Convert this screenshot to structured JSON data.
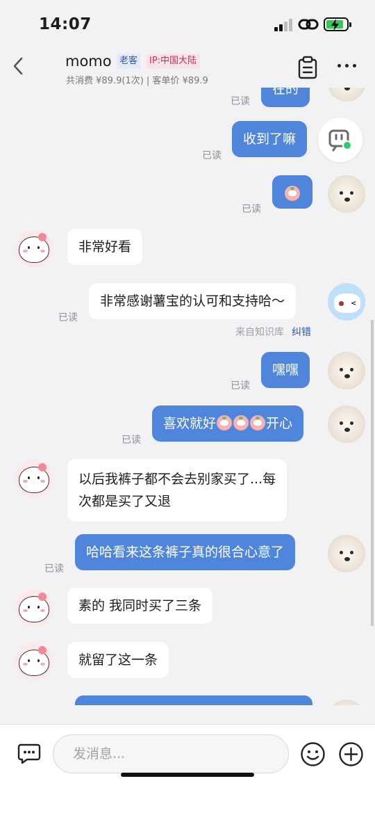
{
  "status_bar": {
    "time": "14:07"
  },
  "header": {
    "name": "momo",
    "tag_customer": "老客",
    "tag_ip": "IP:中国大陆",
    "summary": "共消费 ¥89.9(1次) | 客单价 ¥89.9"
  },
  "messages": [
    {
      "from": "agent",
      "text": "在的",
      "status": "已读"
    },
    {
      "from": "agent",
      "text": "收到了嘛",
      "status": "已读"
    },
    {
      "from": "agent",
      "text": "",
      "emoji": "peach-emoji",
      "status": "已读"
    },
    {
      "from": "customer",
      "text": "非常好看"
    },
    {
      "from": "bot",
      "text": "非常感谢薯宝的认可和支持哈～",
      "status": "已读",
      "source": "来自知识库",
      "correct": "纠错"
    },
    {
      "from": "agent",
      "text": "嘿嘿",
      "status": "已读"
    },
    {
      "from": "agent",
      "text_before": "喜欢就好",
      "text_after": "开心",
      "emoji": "peach-emoji",
      "status": "已读"
    },
    {
      "from": "customer",
      "line1": "以后我裤子都不会去别家买了...每",
      "line2": "次都是买了又退"
    },
    {
      "from": "agent",
      "text": "哈哈看来这条裤子真的很合心意了",
      "status": "已读"
    },
    {
      "from": "customer",
      "text": "素的 我同时买了三条"
    },
    {
      "from": "customer",
      "text": "就留了这一条"
    }
  ],
  "input": {
    "placeholder": "发消息..."
  },
  "icons": {
    "back": "chevron-left-icon",
    "clipboard": "clipboard-icon",
    "more": "more-icon",
    "quick_reply": "chat-bubble-icon",
    "emoji": "smiley-icon",
    "plus": "plus-icon"
  },
  "colors": {
    "outgoing_bubble": "#4f86dc",
    "background": "#f2f2f4",
    "link": "#2b57b8"
  }
}
